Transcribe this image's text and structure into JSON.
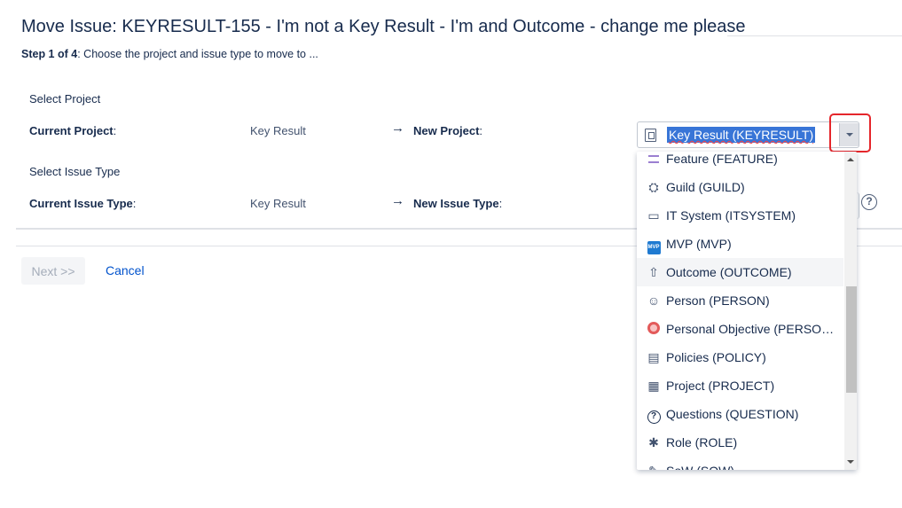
{
  "header": {
    "title": "Move Issue: KEYRESULT-155 - I'm not a Key Result - I'm and Outcome - change me please",
    "step_prefix": "Step 1 of 4",
    "step_text": ": Choose the project and issue type to move to ..."
  },
  "project_section": {
    "heading": "Select Project",
    "current_label": "Current Project",
    "colon": ":",
    "current_value": "Key Result",
    "arrow": "→",
    "new_label": "New Project",
    "new_colon": ":",
    "selected_value": "Key Result (KEYRESULT)"
  },
  "issue_type_section": {
    "heading": "Select Issue Type",
    "current_label": "Current Issue Type",
    "colon": ":",
    "current_value": "Key Result",
    "arrow": "→",
    "new_label": "New Issue Type",
    "new_colon": ":",
    "help_glyph": "?"
  },
  "actions": {
    "next_label": "Next >>",
    "cancel_label": "Cancel"
  },
  "dropdown": {
    "items": [
      {
        "label": "Feature (FEATURE)",
        "icon": "feature-icon"
      },
      {
        "label": "Guild (GUILD)",
        "icon": "guild-icon"
      },
      {
        "label": "IT System (ITSYSTEM)",
        "icon": "it-system-icon"
      },
      {
        "label": "MVP (MVP)",
        "icon": "mvp-icon",
        "icon_text": "MVP"
      },
      {
        "label": "Outcome (OUTCOME)",
        "icon": "upload-icon"
      },
      {
        "label": "Person (PERSON)",
        "icon": "person-icon"
      },
      {
        "label": "Personal Objective (PERSON...",
        "icon": "target-icon"
      },
      {
        "label": "Policies (POLICY)",
        "icon": "document-icon"
      },
      {
        "label": "Project (PROJECT)",
        "icon": "clipboard-icon"
      },
      {
        "label": "Questions (QUESTION)",
        "icon": "question-icon"
      },
      {
        "label": "Role (ROLE)",
        "icon": "gear-icon"
      },
      {
        "label": "SoW (SOW)",
        "icon": "sow-icon"
      }
    ],
    "hovered_index": 4
  },
  "colors": {
    "link": "#0052cc",
    "selection": "#3875d7",
    "highlight_border": "#e5262b"
  }
}
